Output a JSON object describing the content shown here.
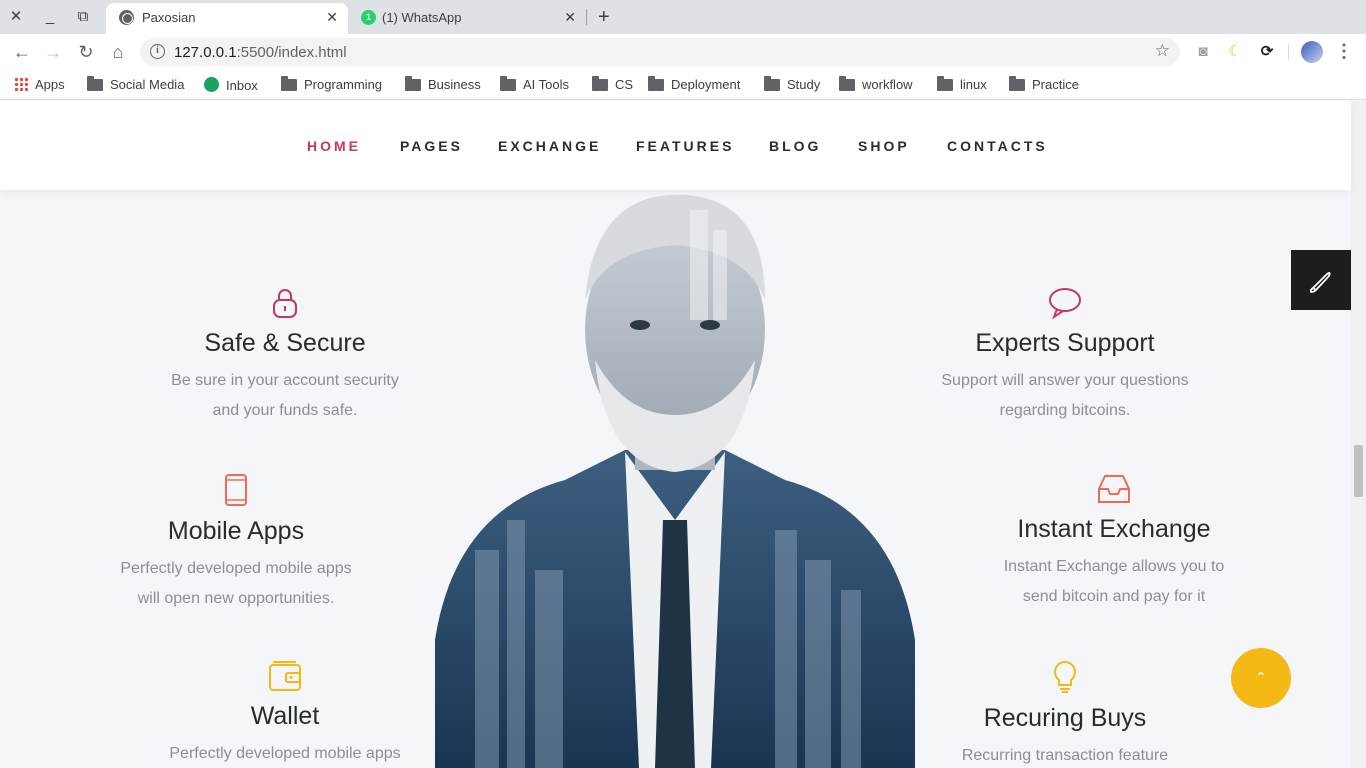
{
  "browser": {
    "tabs": [
      {
        "title": "Paxosian",
        "icon": "globe-icon",
        "active": true
      },
      {
        "title": "(1) WhatsApp",
        "icon": "whatsapp-icon",
        "badge": "1",
        "active": false
      }
    ],
    "address": {
      "host": "127.0.0.1",
      "rest": ":5500/index.html"
    },
    "bookmarks": [
      {
        "label": "Apps",
        "icon": "apps-grid-icon"
      },
      {
        "label": "Social Media",
        "icon": "folder-icon"
      },
      {
        "label": "Inbox",
        "icon": "inbox-icon"
      },
      {
        "label": "Programming",
        "icon": "folder-icon"
      },
      {
        "label": "Business",
        "icon": "folder-icon"
      },
      {
        "label": "AI Tools",
        "icon": "folder-icon"
      },
      {
        "label": "CS",
        "icon": "folder-icon"
      },
      {
        "label": "Deployment",
        "icon": "folder-icon"
      },
      {
        "label": "Study",
        "icon": "folder-icon"
      },
      {
        "label": "workflow",
        "icon": "folder-icon"
      },
      {
        "label": "linux",
        "icon": "folder-icon"
      },
      {
        "label": "Practice",
        "icon": "folder-icon"
      }
    ]
  },
  "site": {
    "nav": [
      "HOME",
      "PAGES",
      "EXCHANGE",
      "FEATURES",
      "BLOG",
      "SHOP",
      "CONTACTS"
    ],
    "active_nav": "HOME",
    "features": [
      {
        "title": "Safe & Secure",
        "lines": [
          "Be sure in your account security",
          "and your funds safe."
        ],
        "icon": "lock-icon",
        "color": "#c8385a"
      },
      {
        "title": "Mobile Apps",
        "lines": [
          "Perfectly developed mobile apps",
          "will open new opportunities."
        ],
        "icon": "smartphone-icon",
        "color": "#ef6b55"
      },
      {
        "title": "Wallet",
        "lines": [
          "Perfectly developed mobile apps"
        ],
        "icon": "wallet-icon",
        "color": "#f5b915"
      },
      {
        "title": "Experts Support",
        "lines": [
          "Support will answer your questions",
          "regarding bitcoins."
        ],
        "icon": "chat-bubble-icon",
        "color": "#c8385a"
      },
      {
        "title": "Instant Exchange",
        "lines": [
          "Instant Exchange allows you to",
          "send bitcoin and pay for it"
        ],
        "icon": "inbox-tray-icon",
        "color": "#ef6b55"
      },
      {
        "title": "Recuring Buys",
        "lines": [
          "Recurring transaction feature"
        ],
        "icon": "lightbulb-icon",
        "color": "#f5b915"
      }
    ]
  },
  "colors": {
    "accent": "#c8385a",
    "scroll_top": "#f5b915",
    "tool_panel": "#1d1d1f"
  }
}
